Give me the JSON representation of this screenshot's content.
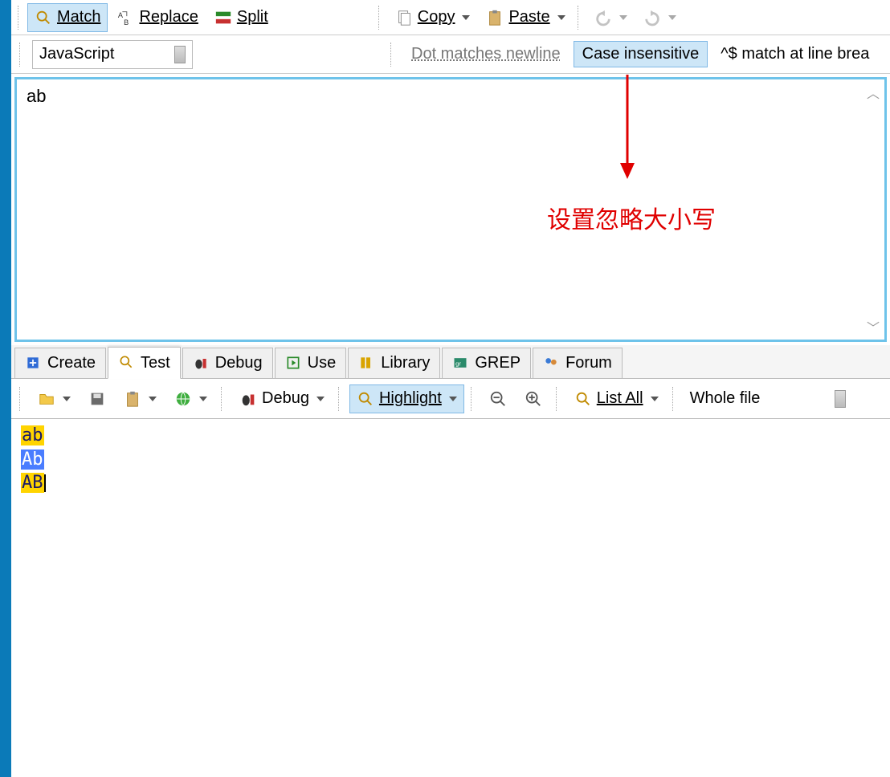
{
  "toolbar1": {
    "match": "Match",
    "replace": "Replace",
    "split": "Split",
    "copy": "Copy",
    "paste": "Paste"
  },
  "langRow": {
    "language": "JavaScript",
    "dot_matches": "Dot matches newline",
    "case_insensitive": "Case insensitive",
    "linebreak_anchors": "^$ match at line brea"
  },
  "regex": {
    "pattern": "ab"
  },
  "annotation": {
    "text": "设置忽略大小写"
  },
  "tabs": {
    "create": "Create",
    "test": "Test",
    "debug": "Debug",
    "use": "Use",
    "library": "Library",
    "grep": "GREP",
    "forum": "Forum"
  },
  "toolbar2": {
    "debug": "Debug",
    "highlight": "Highlight",
    "list_all": "List All",
    "scope": "Whole file"
  },
  "results": {
    "line1": "ab",
    "line2": "Ab",
    "line3": "AB"
  }
}
